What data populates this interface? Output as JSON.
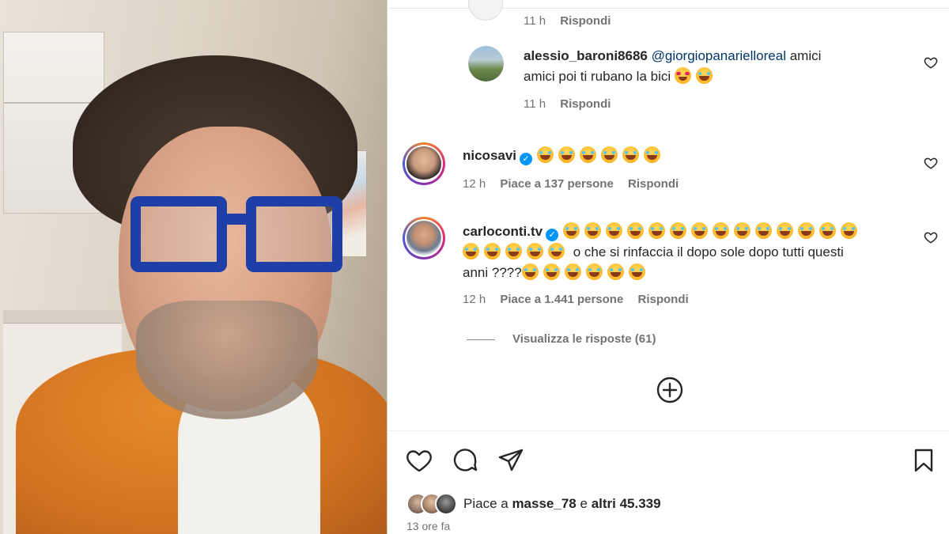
{
  "comments": [
    {
      "time": "11 h",
      "reply_label": "Rispondi"
    },
    {
      "username": "alessio_baroni8686",
      "mention": "@giorgiopanarielloreal",
      "text_line1": "amici",
      "text_line2": "amici poi ti rubano la bici",
      "time": "11 h",
      "reply_label": "Rispondi"
    },
    {
      "username": "nicosavi",
      "time": "12 h",
      "likes": "Piace a 137 persone",
      "reply_label": "Rispondi"
    },
    {
      "username": "carloconti.tv",
      "text": "o che si rinfaccia il dopo sole dopo tutti questi",
      "text_line3": "anni ????",
      "time": "12 h",
      "likes": "Piace a 1.441 persone",
      "reply_label": "Rispondi"
    }
  ],
  "view_replies": "Visualizza le risposte (61)",
  "footer": {
    "likes_prefix": "Piace a",
    "likes_user": "masse_78",
    "likes_join": "e",
    "likes_others": "altri 45.339",
    "time_ago": "13 ore fa"
  },
  "icons": {
    "like": "heart-icon",
    "comment": "comment-bubble-icon",
    "share": "paper-plane-icon",
    "save": "bookmark-icon",
    "load_more": "plus-circle-icon"
  },
  "colors": {
    "verified": "#0095f6",
    "mention": "#00376b",
    "meta": "#737373",
    "text": "#262626"
  }
}
